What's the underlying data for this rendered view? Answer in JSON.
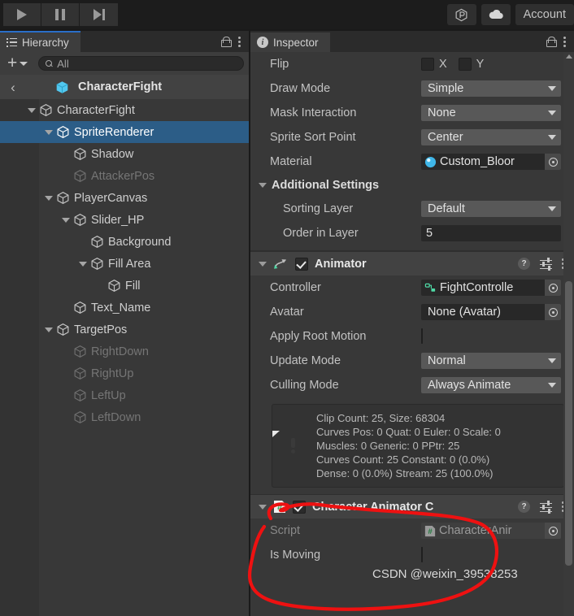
{
  "toolbar": {
    "play_label": "play-button",
    "pause_label": "pause-button",
    "step_label": "step-button",
    "cloud_label": "cloud-icon",
    "services_label": "services-icon",
    "account_label": "Account"
  },
  "hierarchy": {
    "tab_label": "Hierarchy",
    "add_label": "+",
    "search_placeholder": "All",
    "search_value": "All",
    "breadcrumb": "CharacterFight",
    "tree": [
      {
        "label": "CharacterFight",
        "depth": 1,
        "arrow": true,
        "selected": false,
        "dim": false
      },
      {
        "label": "SpriteRenderer",
        "depth": 2,
        "arrow": true,
        "selected": true,
        "dim": false
      },
      {
        "label": "Shadow",
        "depth": 3,
        "arrow": false,
        "selected": false,
        "dim": false
      },
      {
        "label": "AttackerPos",
        "depth": 3,
        "arrow": false,
        "selected": false,
        "dim": true
      },
      {
        "label": "PlayerCanvas",
        "depth": 2,
        "arrow": true,
        "selected": false,
        "dim": false
      },
      {
        "label": "Slider_HP",
        "depth": 3,
        "arrow": true,
        "selected": false,
        "dim": false
      },
      {
        "label": "Background",
        "depth": 4,
        "arrow": false,
        "selected": false,
        "dim": false
      },
      {
        "label": "Fill Area",
        "depth": 4,
        "arrow": true,
        "selected": false,
        "dim": false
      },
      {
        "label": "Fill",
        "depth": 5,
        "arrow": false,
        "selected": false,
        "dim": false
      },
      {
        "label": "Text_Name",
        "depth": 3,
        "arrow": false,
        "selected": false,
        "dim": false
      },
      {
        "label": "TargetPos",
        "depth": 2,
        "arrow": true,
        "selected": false,
        "dim": false
      },
      {
        "label": "RightDown",
        "depth": 3,
        "arrow": false,
        "selected": false,
        "dim": true
      },
      {
        "label": "RightUp",
        "depth": 3,
        "arrow": false,
        "selected": false,
        "dim": true
      },
      {
        "label": "LeftUp",
        "depth": 3,
        "arrow": false,
        "selected": false,
        "dim": true
      },
      {
        "label": "LeftDown",
        "depth": 3,
        "arrow": false,
        "selected": false,
        "dim": true
      }
    ]
  },
  "inspector": {
    "tab_label": "Inspector",
    "sprite_renderer": {
      "flip_label": "Flip",
      "flip_x_label": "X",
      "flip_y_label": "Y",
      "flip_x_checked": false,
      "flip_y_checked": false,
      "draw_mode_label": "Draw Mode",
      "draw_mode_value": "Simple",
      "mask_interaction_label": "Mask Interaction",
      "mask_interaction_value": "None",
      "sprite_sort_point_label": "Sprite Sort Point",
      "sprite_sort_point_value": "Center",
      "material_label": "Material",
      "material_value": "Custom_Bloor",
      "additional_settings_label": "Additional Settings",
      "sorting_layer_label": "Sorting Layer",
      "sorting_layer_value": "Default",
      "order_in_layer_label": "Order in Layer",
      "order_in_layer_value": "5"
    },
    "animator": {
      "title": "Animator",
      "enabled": true,
      "controller_label": "Controller",
      "controller_value": "FightControlle",
      "avatar_label": "Avatar",
      "avatar_value": "None (Avatar)",
      "apply_root_motion_label": "Apply Root Motion",
      "apply_root_motion_checked": false,
      "update_mode_label": "Update Mode",
      "update_mode_value": "Normal",
      "culling_mode_label": "Culling Mode",
      "culling_mode_value": "Always Animate",
      "help_lines": [
        "Clip Count: 25, Size: 68304",
        "Curves Pos: 0 Quat: 0 Euler: 0 Scale: 0",
        "Muscles: 0 Generic: 0 PPtr: 25",
        "Curves Count: 25 Constant: 0 (0.0%)",
        "Dense: 0 (0.0%) Stream: 25 (100.0%)"
      ]
    },
    "character_animator": {
      "title": "Character Animator C",
      "enabled": true,
      "script_label": "Script",
      "script_value": "CharacterAnir",
      "is_moving_label": "Is Moving",
      "is_moving_checked": false
    }
  },
  "watermark": "CSDN @weixin_39538253",
  "colors": {
    "selection_blue": "#2c5d87",
    "tab_accent": "#2a6fc9",
    "panel_bg": "#383838",
    "header_bg": "#424242",
    "annotation_red": "#ee1111"
  }
}
